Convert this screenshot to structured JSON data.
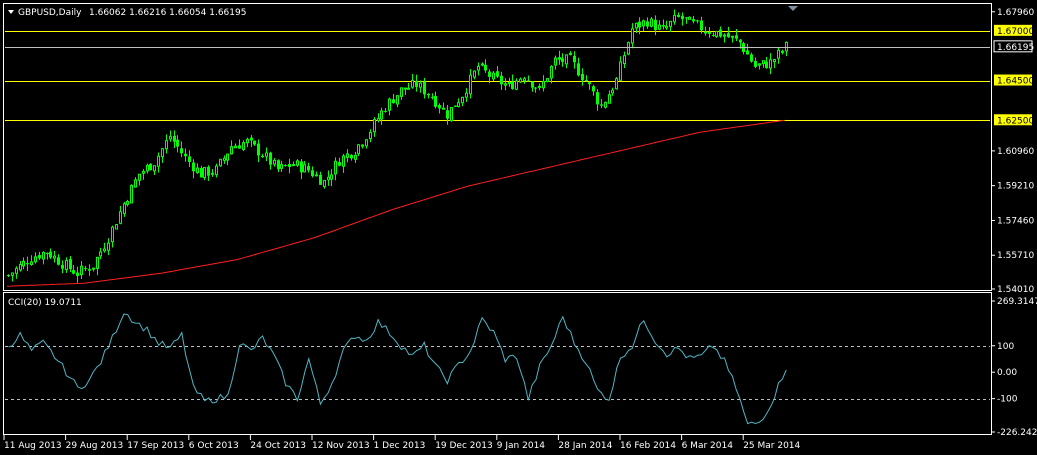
{
  "header": {
    "menu_icon": "triangle-down-icon",
    "symbol": "GBPUSD,Daily",
    "ohlc": "1.66062 1.66216 1.66054 1.66195"
  },
  "indicator": {
    "title": "CCI(20) 19.0711"
  },
  "colors": {
    "background": "#000000",
    "frame": "#ffffff",
    "bull_candle": "#00ff00",
    "bear_candle": "#00ff00",
    "moving_average": "#ff2020",
    "horizontal_line": "#ffff00",
    "price_tag_bg": "#ffff00",
    "cci_line": "#4fb7c6",
    "cci_level": "#c0c0c0"
  },
  "chart_data": [
    {
      "type": "candlestick",
      "symbol": "GBPUSD",
      "timeframe": "Daily",
      "ylim": [
        1.5401,
        1.683
      ],
      "y_ticks": [
        "1.67960",
        "1.66195",
        "1.60960",
        "1.59210",
        "1.57460",
        "1.55710",
        "1.54010"
      ],
      "horizontal_lines": [
        {
          "value": 1.67,
          "label": "1.67000"
        },
        {
          "value": 1.645,
          "label": "1.64500"
        },
        {
          "value": 1.625,
          "label": "1.62500"
        }
      ],
      "current_price": {
        "value": 1.66195,
        "label": "1.66195"
      },
      "x_ticks": [
        "11 Aug 2013",
        "29 Aug 2013",
        "17 Sep 2013",
        "6 Oct 2013",
        "24 Oct 2013",
        "12 Nov 2013",
        "1 Dec 2013",
        "19 Dec 2013",
        "9 Jan 2014",
        "28 Jan 2014",
        "16 Feb 2014",
        "6 Mar 2014",
        "25 Mar 2014"
      ],
      "close_path": [
        [
          0,
          1.547
        ],
        [
          6,
          1.556
        ],
        [
          10,
          1.559
        ],
        [
          14,
          1.553
        ],
        [
          18,
          1.548
        ],
        [
          22,
          1.552
        ],
        [
          26,
          1.566
        ],
        [
          30,
          1.583
        ],
        [
          34,
          1.598
        ],
        [
          38,
          1.604
        ],
        [
          42,
          1.617
        ],
        [
          46,
          1.606
        ],
        [
          50,
          1.598
        ],
        [
          54,
          1.6
        ],
        [
          58,
          1.612
        ],
        [
          62,
          1.614
        ],
        [
          66,
          1.608
        ],
        [
          70,
          1.6
        ],
        [
          74,
          1.603
        ],
        [
          78,
          1.6
        ],
        [
          82,
          1.594
        ],
        [
          86,
          1.605
        ],
        [
          90,
          1.61
        ],
        [
          94,
          1.62
        ],
        [
          98,
          1.632
        ],
        [
          102,
          1.64
        ],
        [
          106,
          1.643
        ],
        [
          110,
          1.637
        ],
        [
          114,
          1.628
        ],
        [
          118,
          1.638
        ],
        [
          122,
          1.652
        ],
        [
          126,
          1.646
        ],
        [
          130,
          1.642
        ],
        [
          134,
          1.648
        ],
        [
          138,
          1.64
        ],
        [
          142,
          1.655
        ],
        [
          146,
          1.655
        ],
        [
          150,
          1.645
        ],
        [
          154,
          1.632
        ],
        [
          158,
          1.645
        ],
        [
          162,
          1.671
        ],
        [
          166,
          1.675
        ],
        [
          170,
          1.67
        ],
        [
          174,
          1.677
        ],
        [
          178,
          1.673
        ],
        [
          182,
          1.67
        ],
        [
          186,
          1.668
        ],
        [
          190,
          1.664
        ],
        [
          194,
          1.652
        ],
        [
          198,
          1.654
        ],
        [
          202,
          1.6619
        ]
      ],
      "moving_average": [
        [
          0,
          1.5415
        ],
        [
          20,
          1.543
        ],
        [
          40,
          1.548
        ],
        [
          60,
          1.555
        ],
        [
          80,
          1.566
        ],
        [
          100,
          1.58
        ],
        [
          120,
          1.592
        ],
        [
          140,
          1.601
        ],
        [
          160,
          1.61
        ],
        [
          180,
          1.619
        ],
        [
          202,
          1.625
        ]
      ]
    },
    {
      "type": "line",
      "name": "CCI(20)",
      "ylim": [
        -226.2421,
        269.3147
      ],
      "y_ticks": [
        "269.3147",
        "100",
        "0.00",
        "-100",
        "-226.2421"
      ],
      "levels": [
        100,
        -100
      ],
      "values": [
        [
          0,
          100
        ],
        [
          3,
          140
        ],
        [
          6,
          80
        ],
        [
          9,
          110
        ],
        [
          12,
          60
        ],
        [
          15,
          0
        ],
        [
          18,
          -60
        ],
        [
          21,
          -30
        ],
        [
          24,
          40
        ],
        [
          27,
          130
        ],
        [
          30,
          230
        ],
        [
          33,
          190
        ],
        [
          36,
          160
        ],
        [
          39,
          110
        ],
        [
          42,
          90
        ],
        [
          45,
          140
        ],
        [
          48,
          -60
        ],
        [
          51,
          -110
        ],
        [
          54,
          -100
        ],
        [
          57,
          -90
        ],
        [
          60,
          110
        ],
        [
          63,
          80
        ],
        [
          66,
          130
        ],
        [
          69,
          60
        ],
        [
          72,
          -40
        ],
        [
          75,
          -100
        ],
        [
          78,
          50
        ],
        [
          81,
          -120
        ],
        [
          84,
          -40
        ],
        [
          87,
          80
        ],
        [
          90,
          140
        ],
        [
          93,
          120
        ],
        [
          96,
          190
        ],
        [
          99,
          150
        ],
        [
          102,
          100
        ],
        [
          105,
          60
        ],
        [
          108,
          100
        ],
        [
          111,
          20
        ],
        [
          114,
          -30
        ],
        [
          117,
          30
        ],
        [
          120,
          80
        ],
        [
          123,
          200
        ],
        [
          126,
          150
        ],
        [
          129,
          50
        ],
        [
          132,
          60
        ],
        [
          135,
          -100
        ],
        [
          138,
          20
        ],
        [
          141,
          100
        ],
        [
          144,
          210
        ],
        [
          147,
          110
        ],
        [
          150,
          40
        ],
        [
          153,
          -70
        ],
        [
          156,
          -100
        ],
        [
          159,
          60
        ],
        [
          162,
          100
        ],
        [
          165,
          200
        ],
        [
          168,
          120
        ],
        [
          171,
          70
        ],
        [
          174,
          90
        ],
        [
          177,
          50
        ],
        [
          180,
          60
        ],
        [
          183,
          100
        ],
        [
          186,
          40
        ],
        [
          189,
          -60
        ],
        [
          192,
          -200
        ],
        [
          195,
          -190
        ],
        [
          198,
          -120
        ],
        [
          202,
          19.07
        ]
      ]
    }
  ]
}
